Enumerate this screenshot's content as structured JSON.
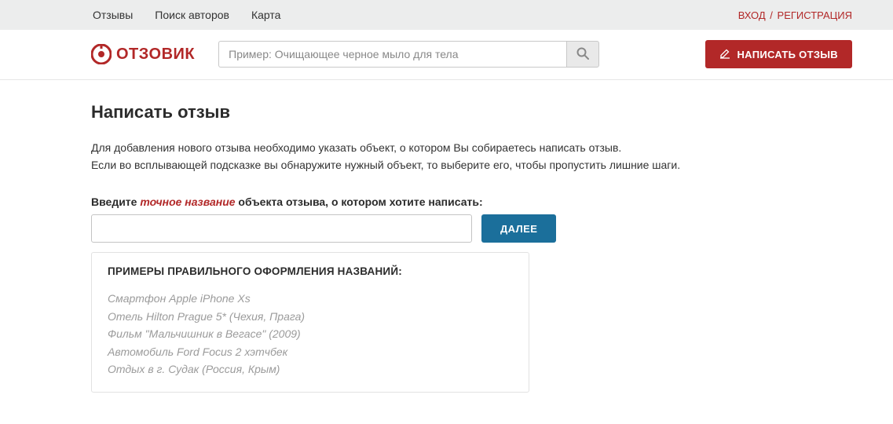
{
  "top_nav": {
    "reviews": "Отзывы",
    "authors": "Поиск авторов",
    "map": "Карта"
  },
  "auth": {
    "login": "ВХОД",
    "sep": "/",
    "register": "РЕГИСТРАЦИЯ"
  },
  "logo": {
    "text": "ОТЗОВИК"
  },
  "search": {
    "placeholder": "Пример: Очищающее черное мыло для тела"
  },
  "write_review_btn": "НАПИСАТЬ ОТЗЫВ",
  "page": {
    "title": "Написать отзыв",
    "intro1": "Для добавления нового отзыва необходимо указать объект, о котором Вы собираетесь написать отзыв.",
    "intro2": "Если во всплывающей подсказке вы обнаружите нужный объект, то выберите его, чтобы пропустить лишние шаги.",
    "prompt_prefix": "Введите ",
    "prompt_accent": "точное название",
    "prompt_suffix": " объекта отзыва, о котором хотите написать:",
    "next_btn": "ДАЛЕЕ",
    "examples_title": "ПРИМЕРЫ ПРАВИЛЬНОГО ОФОРМЛЕНИЯ НАЗВАНИЙ:",
    "examples": [
      "Смартфон Apple iPhone Xs",
      "Отель Hilton Prague 5* (Чехия, Прага)",
      "Фильм \"Мальчишник в Вегасе\" (2009)",
      "Автомобиль Ford Focus 2 хэтчбек",
      "Отдых в г. Судак (Россия, Крым)"
    ]
  }
}
